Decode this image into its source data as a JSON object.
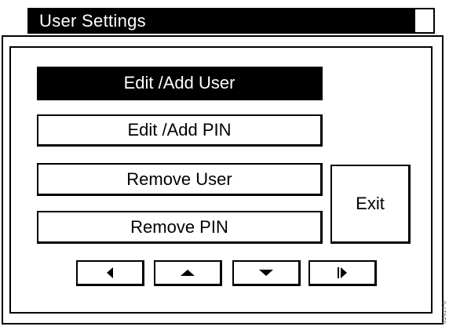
{
  "window": {
    "title": "User Settings"
  },
  "menu": {
    "buttons": [
      {
        "label": "Edit /Add User",
        "selected": true
      },
      {
        "label": "Edit /Add PIN",
        "selected": false
      },
      {
        "label": "Remove User",
        "selected": false
      },
      {
        "label": "Remove PIN",
        "selected": false
      }
    ],
    "exit_label": "Exit"
  },
  "navigation": {
    "icons": [
      "arrow-left-icon",
      "arrow-up-icon",
      "arrow-down-icon",
      "arrow-right-bar-icon"
    ]
  },
  "figure_id": "02417-0"
}
